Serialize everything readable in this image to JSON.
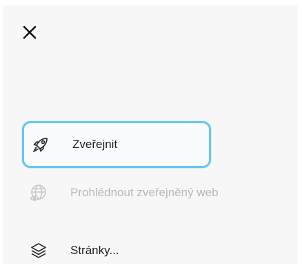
{
  "header": {
    "close_icon": "close-icon"
  },
  "menu": {
    "items": [
      {
        "label": "Zveřejnit",
        "icon": "rocket-icon",
        "state": "focused"
      },
      {
        "label": "Prohlédnout zveřejněný web",
        "icon": "globe-eye-icon",
        "state": "disabled"
      },
      {
        "label": "Stránky...",
        "icon": "layers-icon",
        "state": "normal"
      }
    ]
  },
  "colors": {
    "focus_border": "#68c6ea",
    "text": "#1f1f1f",
    "disabled_text": "#b8b8b8",
    "panel_background": "#f7f7f7"
  }
}
